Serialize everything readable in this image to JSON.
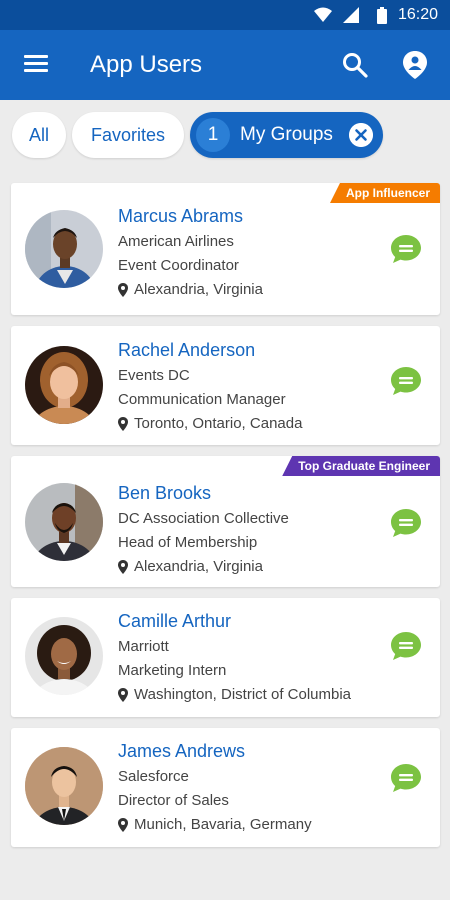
{
  "status_bar": {
    "time": "16:20"
  },
  "app_bar": {
    "title": "App Users",
    "icons": [
      "menu-icon",
      "search-icon",
      "location-pin-icon"
    ]
  },
  "filters": {
    "all": "All",
    "favorites": "Favorites",
    "groups_count": "1",
    "groups_label": "My Groups"
  },
  "colors": {
    "primary": "#1565c0",
    "chat": "#7cc242",
    "badge_orange": "#f57c00",
    "badge_purple": "#5e35b1"
  },
  "users": [
    {
      "name": "Marcus Abrams",
      "company": "American Airlines",
      "role": "Event Coordinator",
      "location": "Alexandria, Virginia",
      "badge": "App Influencer"
    },
    {
      "name": "Rachel Anderson",
      "company": "Events DC",
      "role": "Communication Manager",
      "location": "Toronto, Ontario, Canada"
    },
    {
      "name": "Ben Brooks",
      "company": "DC Association Collective",
      "role": "Head of Membership",
      "location": "Alexandria, Virginia",
      "badge": "Top Graduate Engineer"
    },
    {
      "name": "Camille Arthur",
      "company": "Marriott",
      "role": "Marketing Intern",
      "location": "Washington, District of Columbia"
    },
    {
      "name": "James Andrews",
      "company": "Salesforce",
      "role": "Director of Sales",
      "location": "Munich, Bavaria, Germany"
    }
  ]
}
